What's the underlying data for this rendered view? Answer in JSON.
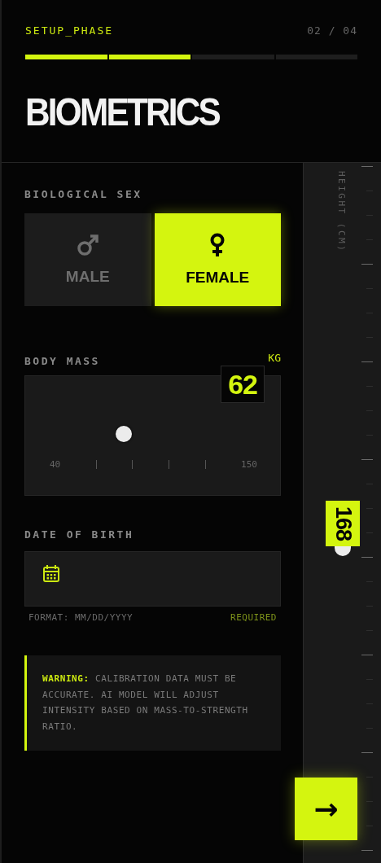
{
  "header": {
    "phase": "SETUP_PHASE",
    "step": "02 / 04",
    "title": "BIOMETRICS",
    "progress": [
      {
        "complete": true
      },
      {
        "complete": true
      },
      {
        "complete": false
      },
      {
        "complete": false
      }
    ]
  },
  "biological_sex": {
    "label": "BIOLOGICAL SEX",
    "options": [
      {
        "kind": "male",
        "label": "MALE",
        "selected": false
      },
      {
        "kind": "female",
        "label": "FEMALE",
        "selected": true
      }
    ]
  },
  "body_mass": {
    "label": "BODY MASS",
    "unit": "KG",
    "value": "62",
    "min_label": "40",
    "max_label": "150"
  },
  "date_of_birth": {
    "label": "DATE OF BIRTH",
    "hint": "FORMAT: MM/DD/YYYY",
    "status": "REQUIRED"
  },
  "warning": {
    "text": "**WARNING:** CALIBRATION DATA MUST BE ACCURATE. AI MODEL WILL ADJUST INTENSITY BASED ON MASS-TO-STRENGTH RATIO."
  },
  "height": {
    "label": "HEIGHT (CM)",
    "value": "168"
  },
  "next_button": {
    "icon": "→"
  }
}
